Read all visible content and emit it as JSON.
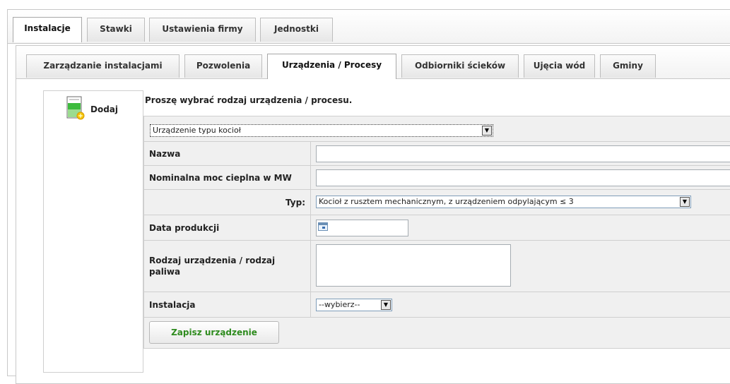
{
  "outer_tabs": [
    {
      "label": "Instalacje",
      "active": true
    },
    {
      "label": "Stawki",
      "active": false
    },
    {
      "label": "Ustawienia firmy",
      "active": false
    },
    {
      "label": "Jednostki",
      "active": false
    }
  ],
  "inner_tabs": [
    {
      "label": "Zarządzanie instalacjami",
      "active": false
    },
    {
      "label": "Pozwolenia",
      "active": false
    },
    {
      "label": "Urządzenia / Procesy",
      "active": true
    },
    {
      "label": "Odbiorniki ścieków",
      "active": false
    },
    {
      "label": "Ujęcia wód",
      "active": false
    },
    {
      "label": "Gminy",
      "active": false
    }
  ],
  "sidebar": {
    "add_label": "Dodaj",
    "add_icon": "add-document-icon"
  },
  "form": {
    "heading": "Proszę wybrać rodzaj urządzenia / procesu.",
    "device_type_select": "Urządzenie typu kocioł",
    "fields": {
      "name_label": "Nazwa",
      "name_value": "",
      "power_label": "Nominalna moc cieplna w MW",
      "power_value": "",
      "type_label": "Typ:",
      "type_value": "Kocioł z rusztem mechanicznym, z urządzeniem odpylającym ≤ 3",
      "production_date_label": "Data produkcji",
      "production_date_value": "",
      "kind_label": "Rodzaj urządzenia / rodzaj paliwa",
      "kind_value": "",
      "installation_label": "Instalacja",
      "installation_value": "--wybierz--"
    },
    "save_label": "Zapisz urządzenie"
  },
  "colors": {
    "save_text": "#2e8b1e",
    "border": "#cfcfcf",
    "label_bg": "#f0f0f0"
  }
}
